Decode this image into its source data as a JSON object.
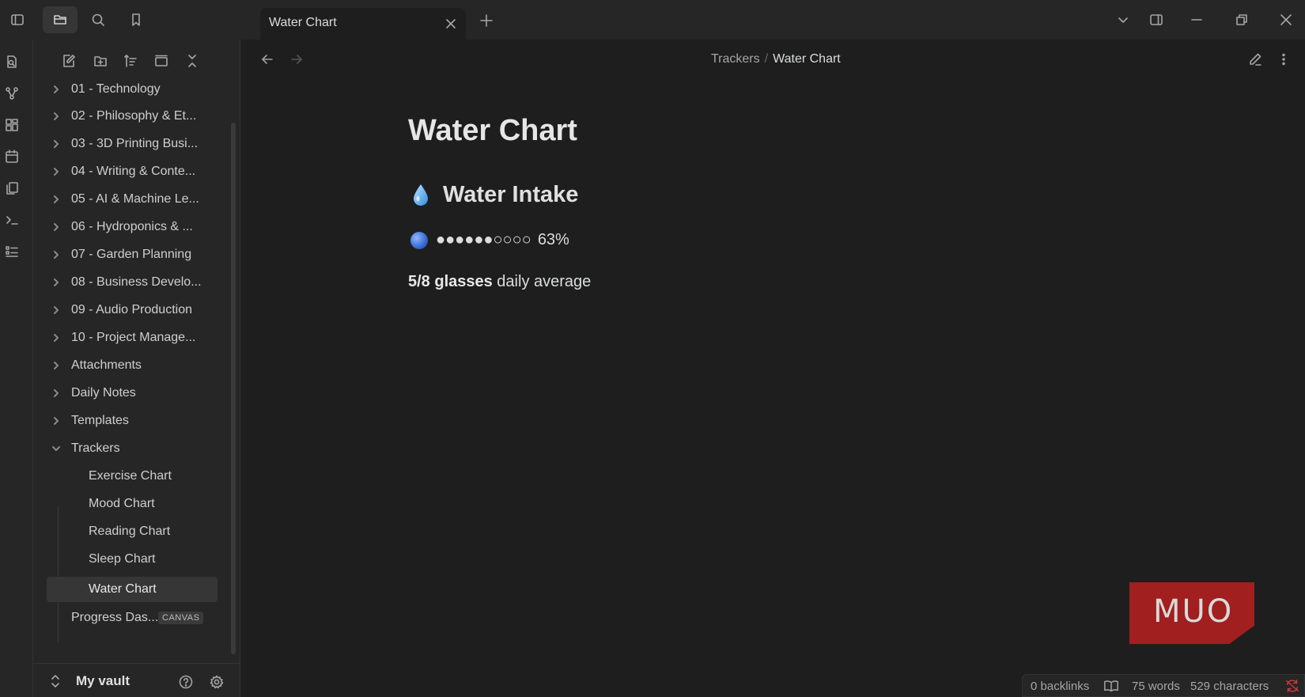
{
  "tab": {
    "title": "Water Chart"
  },
  "breadcrumb": {
    "parent": "Trackers",
    "separator": "/",
    "current": "Water Chart"
  },
  "tree": {
    "folders": [
      "01 - Technology",
      "02 - Philosophy & Et...",
      "03 - 3D Printing Busi...",
      "04 - Writing & Conte...",
      "05 - AI & Machine Le...",
      "06 - Hydroponics & ...",
      "07 - Garden Planning",
      "08 - Business Develo...",
      "09 - Audio Production",
      "10 - Project Manage...",
      "Attachments",
      "Daily Notes",
      "Templates"
    ],
    "open_folder": "Trackers",
    "children": [
      "Exercise Chart",
      "Mood Chart",
      "Reading Chart",
      "Sleep Chart",
      "Water Chart"
    ],
    "selected": "Water Chart",
    "canvas_file": {
      "label": "Progress Das...",
      "badge": "CANVAS"
    }
  },
  "vault": {
    "name": "My vault"
  },
  "document": {
    "title": "Water Chart",
    "heading": "Water Intake",
    "progress_dots": "●●●●●●○○○○",
    "progress_percent": "63%",
    "progress_value": 0.63,
    "avg_bold": "5/8 glasses",
    "avg_rest": " daily average"
  },
  "status": {
    "backlinks": "0 backlinks",
    "words": "75 words",
    "characters": "529 characters"
  },
  "watermark": {
    "text": "MUO"
  },
  "colors": {
    "accent_red": "#a11f1f",
    "sync_error": "#d63a3a",
    "bg": "#1e1e1e",
    "panel": "#262626"
  }
}
